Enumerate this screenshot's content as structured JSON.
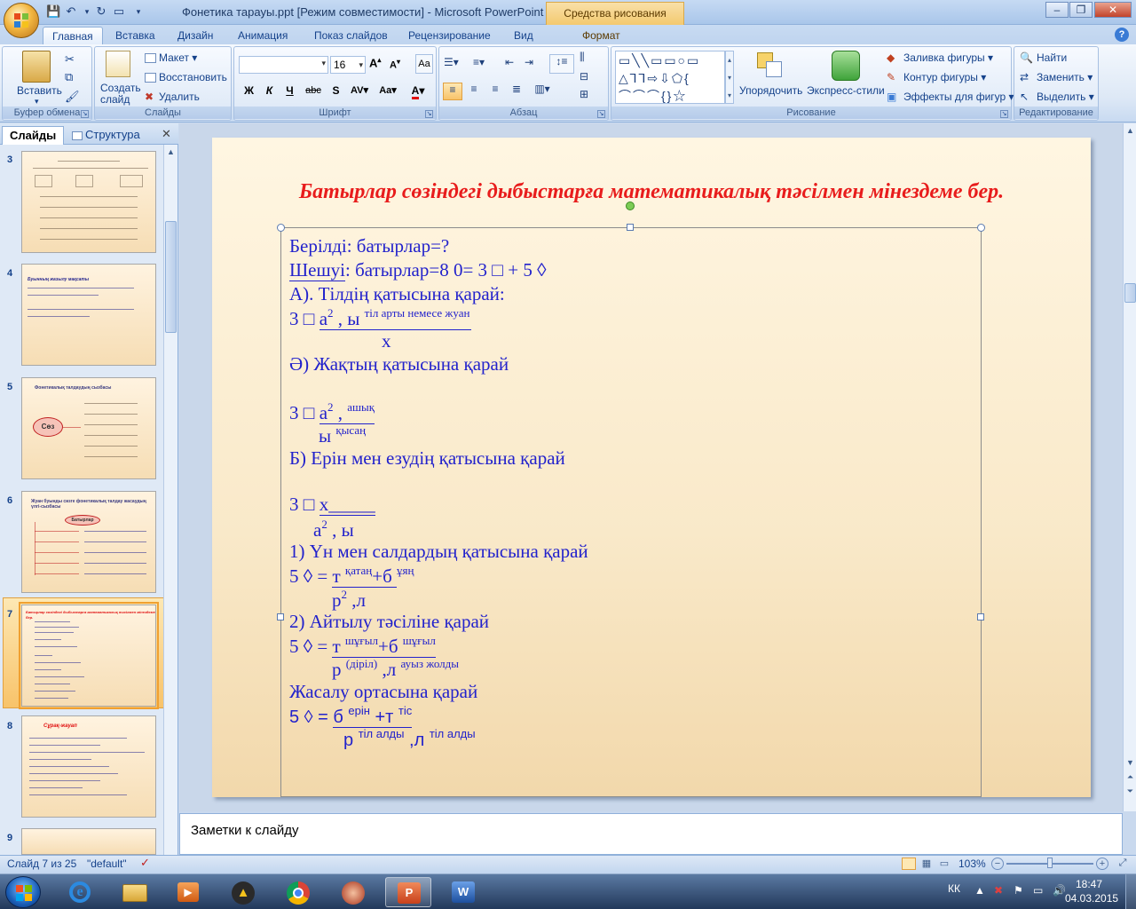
{
  "window": {
    "title": "Фонетика тарауы.ppt [Режим совместимости] - Microsoft PowerPoint",
    "context_group": "Средства рисования"
  },
  "tabs": [
    "Главная",
    "Вставка",
    "Дизайн",
    "Анимация",
    "Показ слайдов",
    "Рецензирование",
    "Вид",
    "Формат"
  ],
  "ribbon": {
    "clipboard": {
      "paste": "Вставить",
      "label": "Буфер обмена"
    },
    "slides": {
      "new_slide": "Создать слайд",
      "layout": "Макет",
      "reset": "Восстановить",
      "delete": "Удалить",
      "label": "Слайды"
    },
    "font": {
      "font_name": "",
      "font_size": "16",
      "label": "Шрифт",
      "bold": "Ж",
      "italic": "К",
      "underline": "Ч",
      "strike": "abc",
      "shadow": "S",
      "spacing": "AV",
      "case": "Aa",
      "color": "A"
    },
    "paragraph": {
      "label": "Абзац"
    },
    "drawing": {
      "arrange": "Упорядочить",
      "quick_styles": "Экспресс-стили",
      "fill": "Заливка фигуры",
      "outline": "Контур фигуры",
      "effects": "Эффекты для фигур",
      "label": "Рисование"
    },
    "editing": {
      "find": "Найти",
      "replace": "Заменить",
      "select": "Выделить",
      "label": "Редактирование"
    }
  },
  "pane": {
    "tab_slides": "Слайды",
    "tab_outline": "Структура",
    "thumbs": [
      {
        "num": "3"
      },
      {
        "num": "4",
        "text": "Буынның жазылу мақсаты"
      },
      {
        "num": "5",
        "title": "Фонетикалық талдаудың сызбасы",
        "node": "Сөз"
      },
      {
        "num": "6",
        "title": "Жуан буынды сөзге фонетикалық талдау жасаудың үлгі-сызбасы",
        "node": "Батырлар"
      },
      {
        "num": "7",
        "title": "Батырлар сөзіндегі дыбыстарға математикалық тәсілмен мінездеме бер."
      },
      {
        "num": "8",
        "title": "Сұрақ-жауап"
      },
      {
        "num": "9"
      }
    ]
  },
  "slide": {
    "title": "Батырлар сөзіндегі дыбыстарға математикалық тәсілмен мінездеме бер.",
    "lines": {
      "l1": "Берілді: батырлар=?",
      "l2a": "Шешуі",
      "l2b": ": батырлар=8 0= 3 □ + 5 ◊",
      "l3": "А). Тілдің қатысына қарай:",
      "l4a": "3 □ ",
      "l4b": "а",
      "l4c": "2",
      "l4d": " , ы ",
      "l4e": "тіл арты немесе жуан",
      "l5": "х",
      "l6": "Ә) Жақтың қатысына қарай",
      "l7a": "3 □ ",
      "l7b": "а",
      "l7c": "2",
      "l7d": " , ",
      "l7e": "ашық",
      "l8a": "ы",
      "l8b": "қысаң",
      "l9": "Б) Ерін мен езудің қатысына қарай",
      "l10a": "3 □ ",
      "l10b": "х_____",
      "l11a": "а",
      "l11b": "2",
      "l11c": " , ы",
      "l12": "1) Үн мен салдардың қатысына қарай",
      "l13a": "5 ◊ = ",
      "l13b": "т ",
      "l13c": "қатаң",
      "l13d": "+б ",
      "l13e": "ұяң",
      "l14a": "р",
      "l14b": "2",
      "l14c": "  ,л",
      "l15": "2) Айтылу тәсіліне қарай",
      "l16a": "5 ◊ = ",
      "l16b": "т ",
      "l16c": "шұғыл",
      "l16d": "+б ",
      "l16e": "шұғыл",
      "l17a": "р ",
      "l17b": "(діріл)",
      "l17c": "   ,л ",
      "l17d": "ауыз жолды",
      "l18": "Жасалу ортасына қарай",
      "l19a": "5 ◊ = ",
      "l19b": "б ",
      "l19c": "ерін",
      "l19d": " +т ",
      "l19e": "тіс",
      "l20a": "р ",
      "l20b": "тіл алды",
      "l20c": " ,л ",
      "l20d": "тіл алды"
    }
  },
  "notes": {
    "placeholder": "Заметки к слайду"
  },
  "status": {
    "slide": "Слайд 7 из 25",
    "theme": "\"default\"",
    "zoom": "103%"
  },
  "taskbar": {
    "lang": "КК",
    "time": "18:47",
    "date": "04.03.2015"
  }
}
